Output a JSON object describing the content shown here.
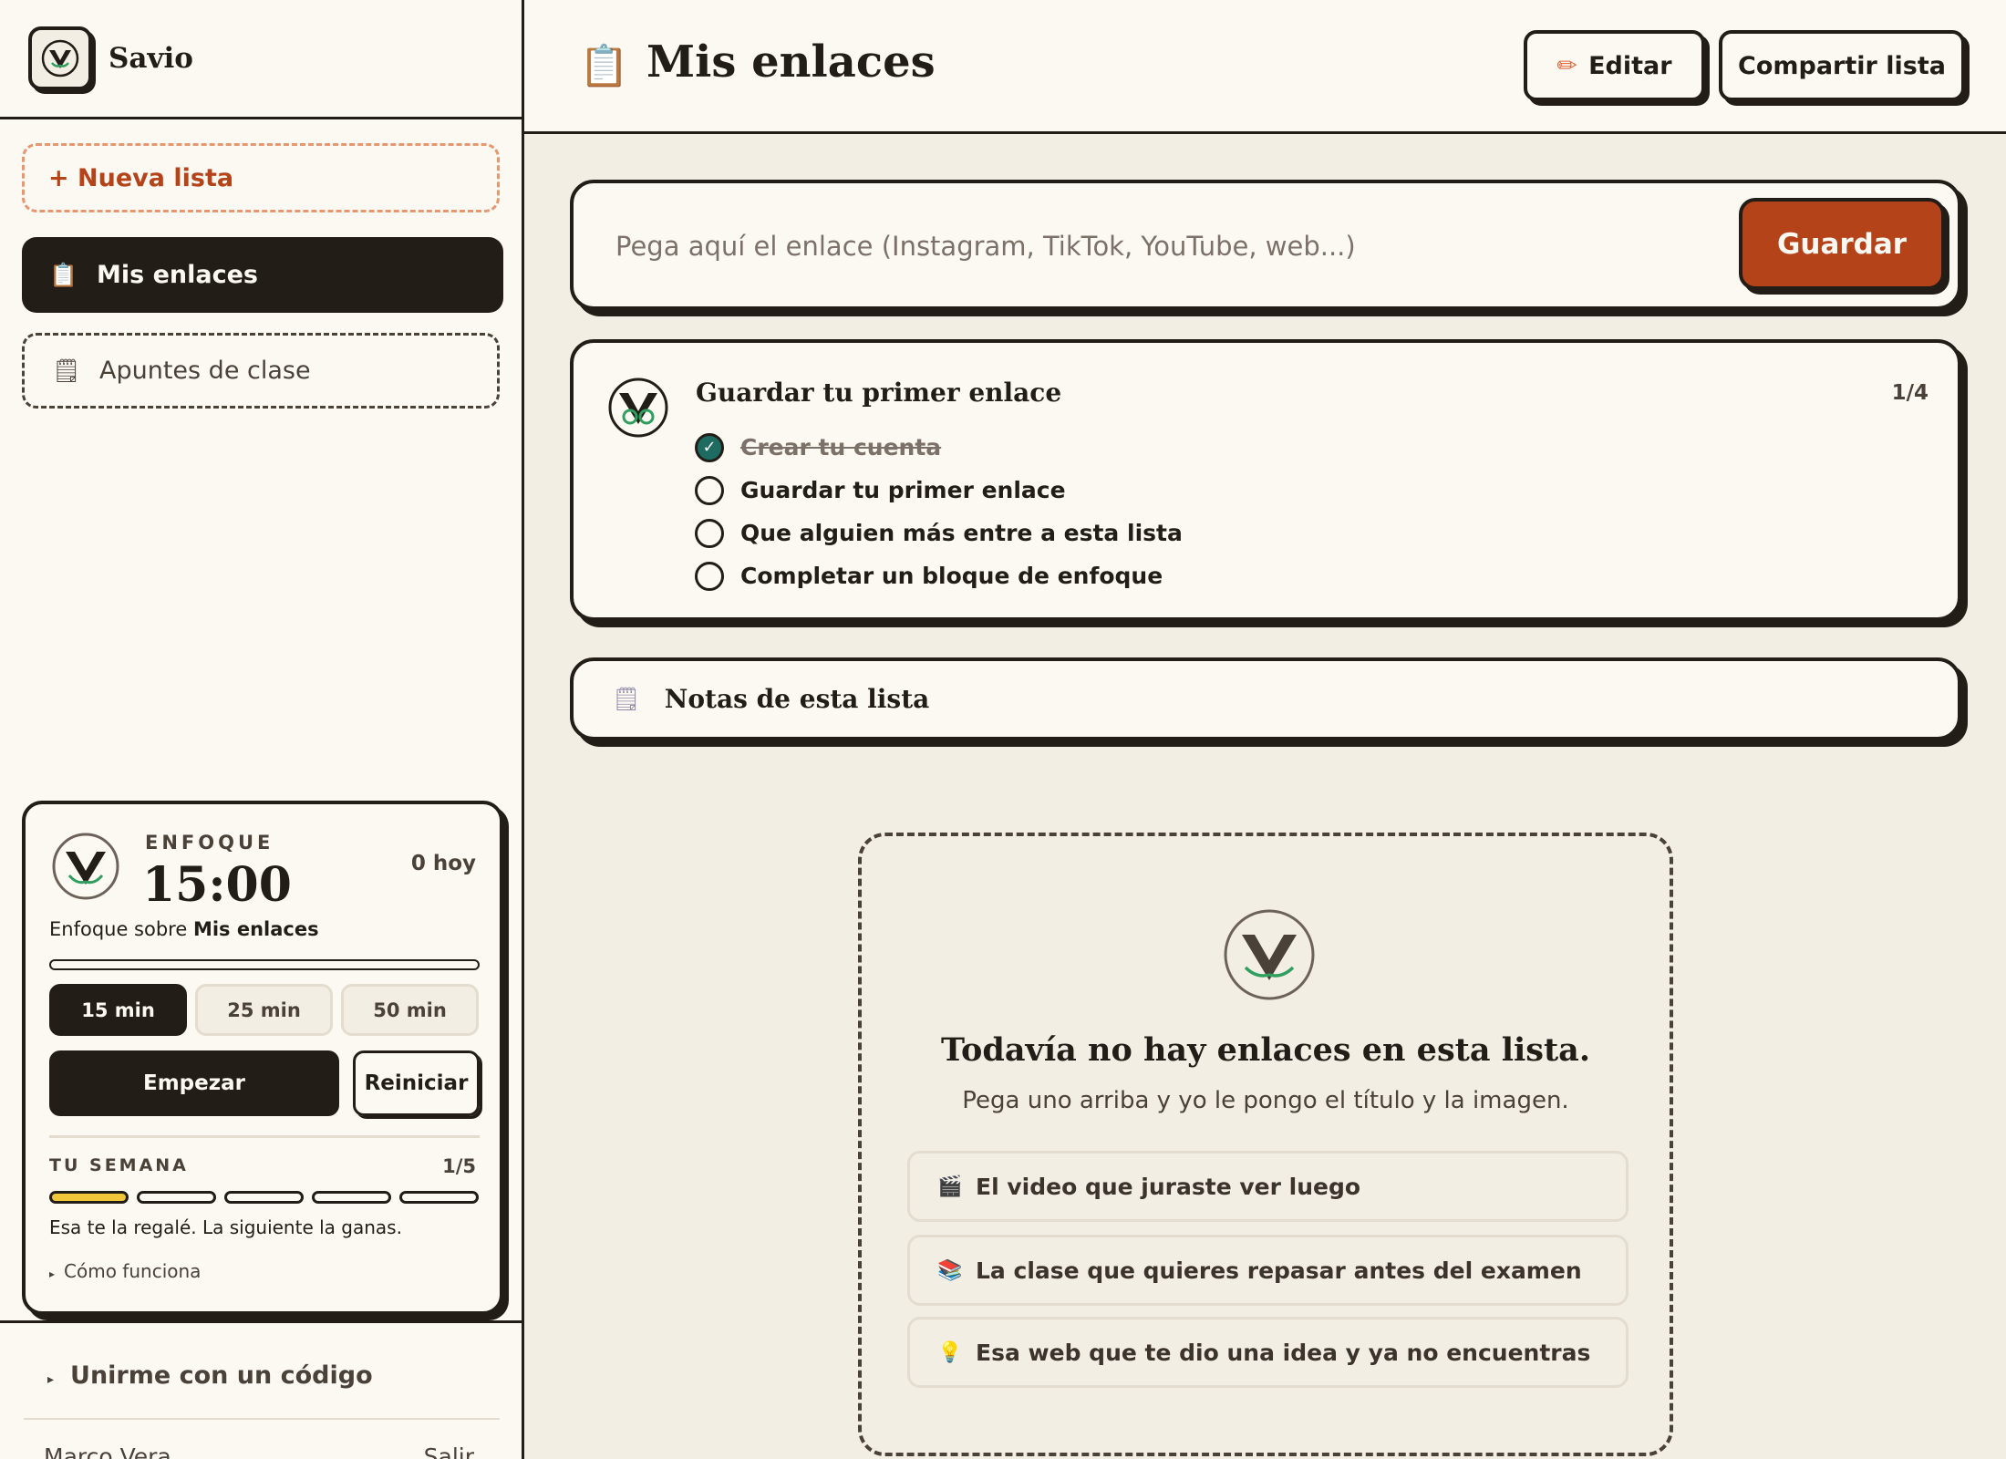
{
  "brand": {
    "name": "Savio"
  },
  "sidebar": {
    "new_list": "+ Nueva lista",
    "lists": [
      {
        "icon": "clipboard-icon",
        "label": "Mis enlaces"
      },
      {
        "icon": "notepad-icon",
        "label": "Apuntes de clase"
      }
    ]
  },
  "focus": {
    "label": "ENFOQUE",
    "time": "15:00",
    "today": "0 hoy",
    "desc_prefix": "Enfoque sobre ",
    "desc_list": "Mis enlaces",
    "progress": 0,
    "durations": [
      "15 min",
      "25 min",
      "50 min"
    ],
    "selected_duration": "15 min",
    "start": "Empezar",
    "reset": "Reiniciar",
    "week_label": "TU SEMANA",
    "week_count": "1/5",
    "week_done": 1,
    "week_total": 5,
    "week_message": "Esa te la regalé. La siguiente la ganas.",
    "how": "Cómo funciona"
  },
  "join": "Unirme con un código",
  "user": {
    "name": "Marco Vera",
    "logout": "Salir"
  },
  "header": {
    "title": "Mis enlaces",
    "edit": "Editar",
    "share": "Compartir lista"
  },
  "url": {
    "placeholder": "Pega aquí el enlace (Instagram, TikTok, YouTube, web...)",
    "save": "Guardar"
  },
  "checklist": {
    "title": "Guardar tu primer enlace",
    "count": "1/4",
    "items": [
      {
        "label": "Crear tu cuenta",
        "done": true
      },
      {
        "label": "Guardar tu primer enlace",
        "done": false
      },
      {
        "label": "Que alguien más entre a esta lista",
        "done": false
      },
      {
        "label": "Completar un bloque de enfoque",
        "done": false
      }
    ]
  },
  "notes": {
    "label": "Notas de esta lista"
  },
  "empty": {
    "title": "Todavía no hay enlaces en esta lista.",
    "subtitle": "Pega uno arriba y yo le pongo el título y la imagen.",
    "suggestions": [
      {
        "icon": "clapperboard-icon",
        "label": "El video que juraste ver luego"
      },
      {
        "icon": "books-icon",
        "label": "La clase que quieres repasar antes del examen"
      },
      {
        "icon": "lightbulb-icon",
        "label": "Esa web que te dio una idea y ya no encuentras"
      }
    ]
  },
  "colors": {
    "ink": "#231d17",
    "paper": "#fcf9f3",
    "background": "#f3eee4",
    "accent": "#b5431a",
    "check": "#1d6b61",
    "week_highlight": "#f0c63b",
    "logo_green": "#2f9e5e"
  }
}
